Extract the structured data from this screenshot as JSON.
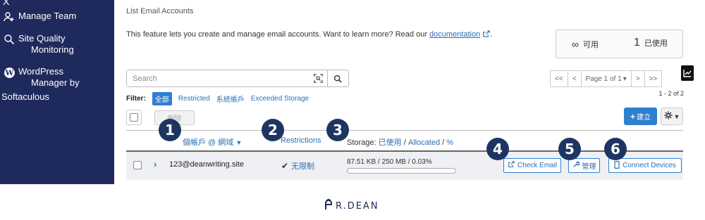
{
  "sidebar": {
    "close_symbol": "X",
    "items": [
      {
        "label": "Manage Team",
        "icon": "team-icon"
      },
      {
        "label_line1": "Site Quality",
        "label_line2": "Monitoring",
        "icon": "search-icon"
      },
      {
        "label_line1": "WordPress",
        "label_line2": "Manager by",
        "label_line3": "Softaculous",
        "icon": "wordpress-icon"
      }
    ]
  },
  "main": {
    "breadcrumb": "List Email Accounts",
    "intro_text": "This feature lets you create and manage email accounts. Want to learn more? Read our ",
    "intro_link": "documentation",
    "intro_end": ".",
    "stats": {
      "unlimited_symbol": "∞",
      "available_label": "可用",
      "used_value": "1",
      "used_label": "已使用"
    },
    "search": {
      "placeholder": "Search"
    },
    "pager": {
      "first": "<<",
      "prev": "<",
      "page_label": "Page 1 of 1",
      "next": ">",
      "last": ">>"
    },
    "filter": {
      "label": "Filter:",
      "options": [
        "全部",
        "Restricted",
        "系統帳戶",
        "Exceeded Storage"
      ],
      "active_index": 0
    },
    "count_text": "1 - 2 of 2",
    "toolbar": {
      "delete_label": "刪除",
      "create_label": "建立",
      "create_plus": "+"
    },
    "table": {
      "headers": {
        "account": "個帳戶 @ 網域",
        "restrictions": "Restrictions",
        "storage_prefix": "Storage: ",
        "storage_used": "已使用",
        "storage_sep1": " / ",
        "storage_alloc": "Allocated",
        "storage_sep2": " / ",
        "storage_pct": "%"
      },
      "rows": [
        {
          "account": "123@deanwriting.site",
          "restriction": "无限制",
          "storage": "87.51 KB / 250 MB / 0.03%",
          "usage_fraction": 0.0003,
          "check_email": "Check Email",
          "manage": "管理",
          "connect_devices": "Connect Devices"
        }
      ]
    },
    "badges": [
      "1",
      "2",
      "3",
      "4",
      "5",
      "6"
    ]
  },
  "footer": {
    "logo_text": "R.DEAN"
  },
  "colors": {
    "sidebar_bg": "#1f2a5c",
    "accent": "#2f7fd1",
    "badge": "#1e3562"
  }
}
